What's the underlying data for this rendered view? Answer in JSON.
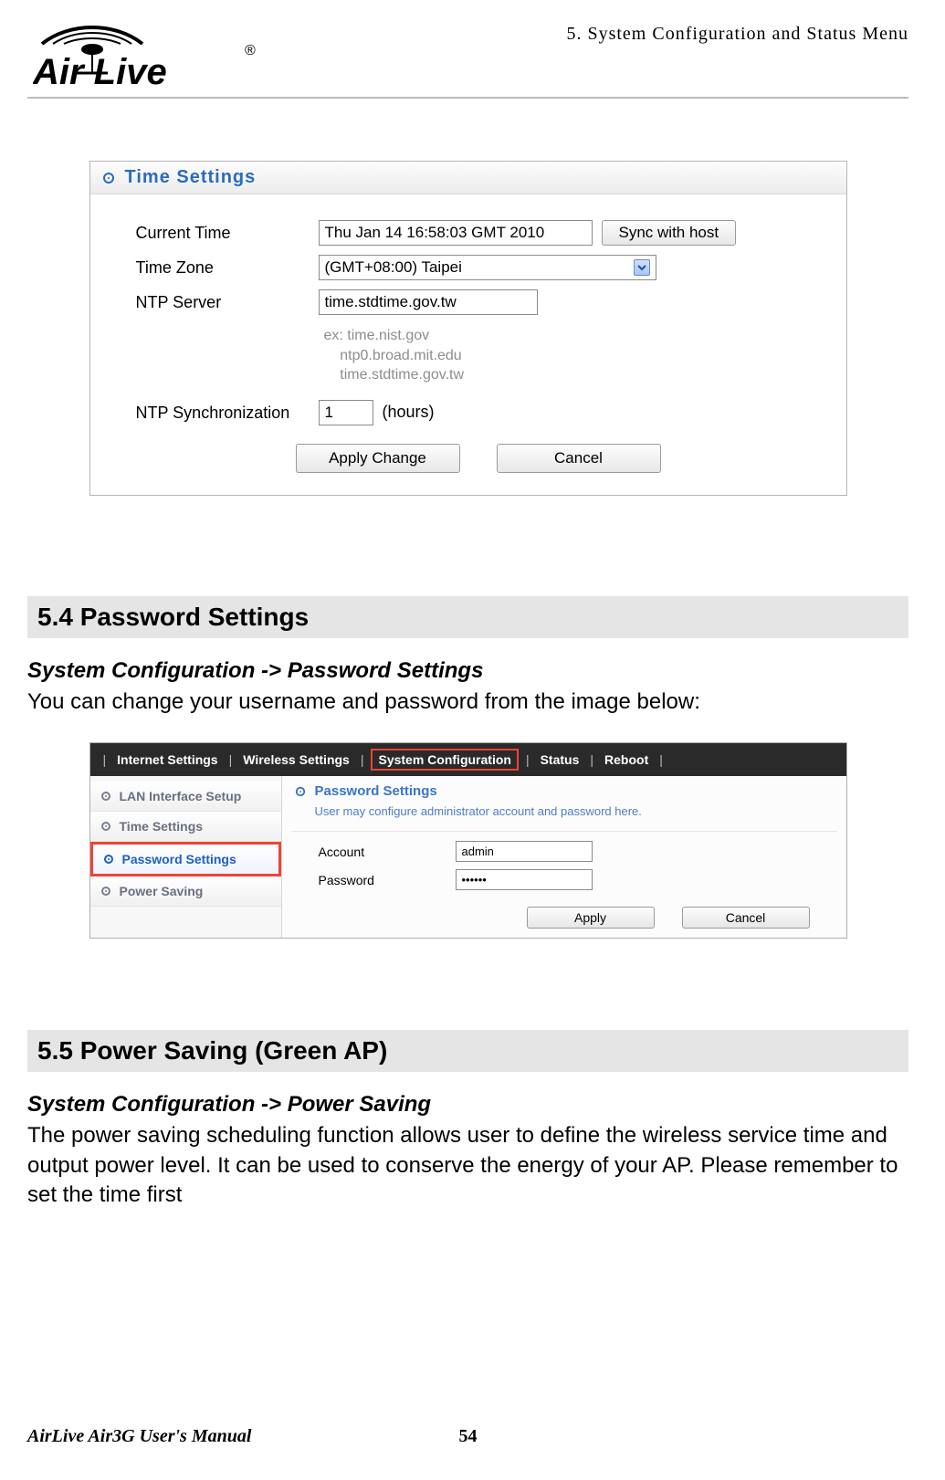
{
  "header": {
    "chapter": "5.  System  Configuration  and  Status  Menu"
  },
  "logo": {
    "brand_main": "Air Live",
    "registered": "®"
  },
  "time_panel": {
    "title": "Time  Settings",
    "labels": {
      "current_time": "Current Time",
      "time_zone": "Time Zone",
      "ntp_server": "NTP Server",
      "ntp_sync": "NTP Synchronization",
      "sync_units": "(hours)"
    },
    "values": {
      "current_time": "Thu Jan 14 16:58:03 GMT 2010",
      "time_zone": "(GMT+08:00) Taipei",
      "ntp_server": "time.stdtime.gov.tw",
      "ntp_sync": "1"
    },
    "hint_prefix": "ex:",
    "hints": [
      "time.nist.gov",
      "ntp0.broad.mit.edu",
      "time.stdtime.gov.tw"
    ],
    "buttons": {
      "sync": "Sync with host",
      "apply": "Apply Change",
      "cancel": "Cancel"
    }
  },
  "section54": {
    "title": "5.4 Password  Settings",
    "breadcrumb": "System Configuration -> Password Settings",
    "desc": "You can change your username and password from the image below:"
  },
  "pw_panel": {
    "tabs": [
      "Internet  Settings",
      "Wireless  Settings",
      "System Configuration",
      "Status",
      "Reboot"
    ],
    "active_tab_index": 2,
    "sidebar": [
      "LAN  Interface  Setup",
      "Time  Settings",
      "Password  Settings",
      "Power  Saving"
    ],
    "active_sidebar_index": 2,
    "panel_title": "Password  Settings",
    "desc": "User may configure administrator account and password here.",
    "labels": {
      "account": "Account",
      "password": "Password"
    },
    "values": {
      "account": "admin",
      "password": "••••••"
    },
    "buttons": {
      "apply": "Apply",
      "cancel": "Cancel"
    }
  },
  "section55": {
    "title": "5.5 Power  Saving  (Green  AP)",
    "breadcrumb": "System Configuration -> Power Saving",
    "desc": "The power saving scheduling function allows user to define the wireless service time and output power level.    It can be used to conserve the energy of your AP.    Please remember to set the time first"
  },
  "footer": {
    "book": "AirLive Air3G User's Manual",
    "page": "54"
  }
}
